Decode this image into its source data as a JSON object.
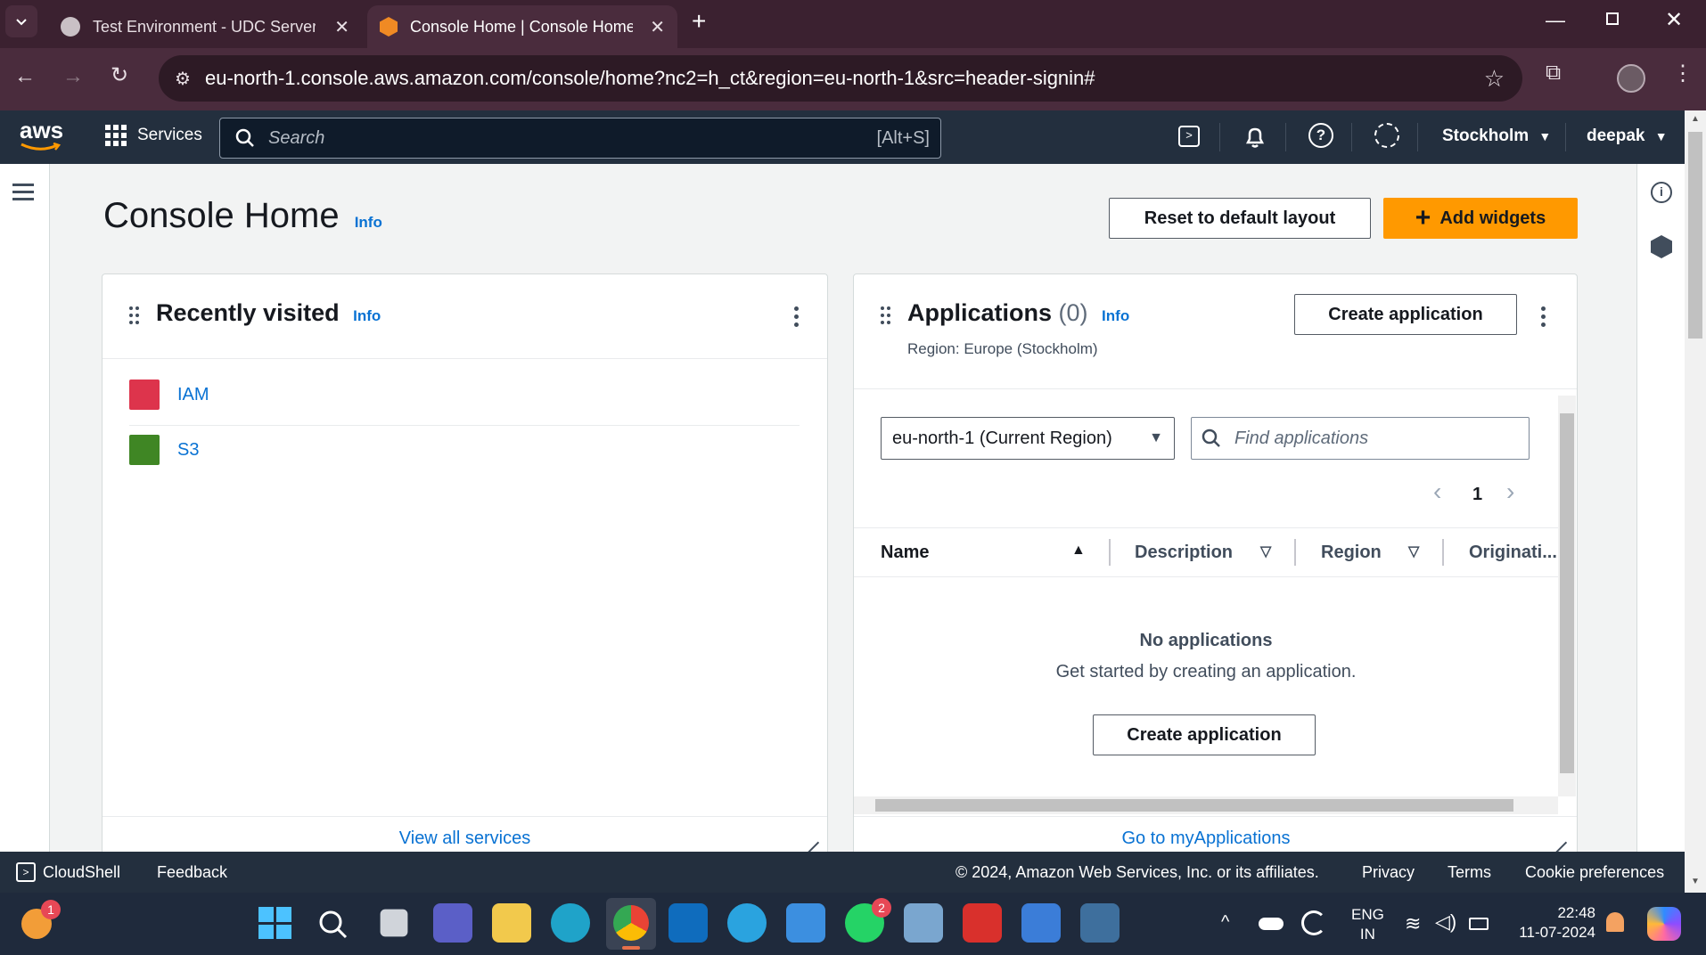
{
  "browser": {
    "tabs": [
      {
        "title": "Test Environment - UDC Server"
      },
      {
        "title": "Console Home | Console Home"
      }
    ],
    "url": "eu-north-1.console.aws.amazon.com/console/home?nc2=h_ct&region=eu-north-1&src=header-signin#"
  },
  "aws_nav": {
    "logo": "aws",
    "services_label": "Services",
    "search_placeholder": "Search",
    "search_shortcut": "[Alt+S]",
    "region": "Stockholm",
    "user": "deepak"
  },
  "page": {
    "title": "Console Home",
    "info": "Info",
    "reset_button": "Reset to default layout",
    "add_widgets_button": "Add widgets"
  },
  "recently_visited": {
    "title": "Recently visited",
    "info": "Info",
    "items": [
      {
        "label": "IAM",
        "color": "#dd344c"
      },
      {
        "label": "S3",
        "color": "#3f8624"
      }
    ],
    "footer_link": "View all services"
  },
  "applications": {
    "title": "Applications",
    "count": "(0)",
    "info": "Info",
    "create_button": "Create application",
    "region_text": "Region: Europe (Stockholm)",
    "region_select": "eu-north-1 (Current Region)",
    "search_placeholder": "Find applications",
    "page_number": "1",
    "columns": [
      "Name",
      "Description",
      "Region",
      "Originati..."
    ],
    "empty_title": "No applications",
    "empty_desc": "Get started by creating an application.",
    "empty_button": "Create application",
    "footer_link": "Go to myApplications"
  },
  "footer": {
    "cloudshell": "CloudShell",
    "feedback": "Feedback",
    "copyright": "© 2024, Amazon Web Services, Inc. or its affiliates.",
    "privacy": "Privacy",
    "terms": "Terms",
    "cookies": "Cookie preferences"
  },
  "taskbar": {
    "weather_badge": "1",
    "whatsapp_badge": "2",
    "lang_top": "ENG",
    "lang_bottom": "IN",
    "time": "22:48",
    "date": "11-07-2024"
  },
  "colors": {
    "aws_nav": "#232f3e",
    "orange": "#ff9900",
    "link": "#0972d3",
    "browser_frame": "#3b2130"
  }
}
